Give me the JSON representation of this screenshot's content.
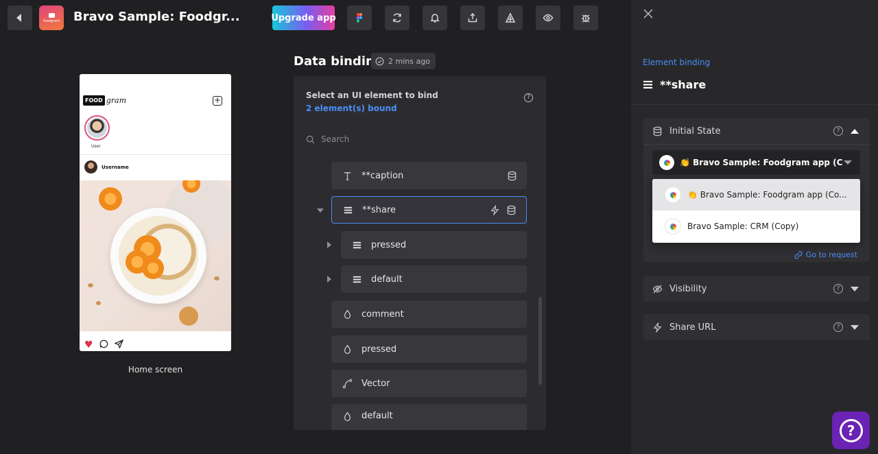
{
  "header": {
    "app_title": "Bravo Sample: Foodgr...",
    "app_logo_text": "foodgram",
    "upgrade_label": "Upgrade app",
    "tools": [
      "figma-icon",
      "refresh-icon",
      "bell-icon",
      "share-icon",
      "deploy-icon",
      "eye-icon",
      "bug-icon"
    ]
  },
  "preview": {
    "logo_food": "FOOD",
    "logo_gram": "gram",
    "story_label": "User",
    "username": "Username",
    "screen_label": "Home screen"
  },
  "data_binding": {
    "title": "Data binding",
    "saved": "2 mins ago",
    "prompt": "Select an UI element to bind",
    "bound_count": "2 element(s) bound",
    "search_placeholder": "Search",
    "items": [
      {
        "label": "**caption",
        "icon": "text-icon"
      },
      {
        "label": "**share",
        "icon": "list-icon",
        "selected": true
      },
      {
        "label": "pressed",
        "icon": "list-icon"
      },
      {
        "label": "default",
        "icon": "list-icon"
      },
      {
        "label": "comment",
        "icon": "drop-icon"
      },
      {
        "label": "pressed",
        "icon": "drop-icon"
      },
      {
        "label": "Vector",
        "icon": "vector-icon"
      },
      {
        "label": "default",
        "icon": "drop-icon"
      }
    ]
  },
  "binding_panel": {
    "eyebrow": "Element binding",
    "title": "**share",
    "initial_state": {
      "label": "Initial State",
      "selected_request": "👏 Bravo Sample: Foodgram app (C",
      "options": [
        "👏 Bravo Sample: Foodgram app (Co...",
        "Bravo Sample: CRM (Copy)"
      ],
      "go_to_request": "Go to request"
    },
    "visibility": {
      "label": "Visibility"
    },
    "share_url": {
      "label": "Share URL"
    }
  },
  "colors": {
    "accent": "#4a8df6",
    "help_fab": "#6a23b4",
    "selected_border": "#4a8df6"
  }
}
